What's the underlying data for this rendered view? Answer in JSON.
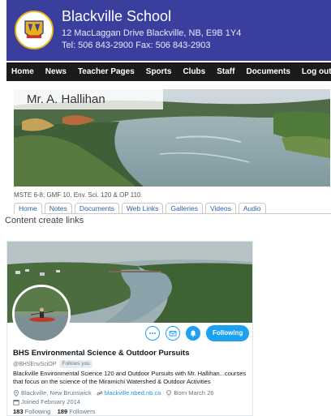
{
  "header": {
    "school_name": "Blackville School",
    "address": "12 MacLaggan Drive Blackville, NB, E9B 1Y4",
    "phone": "Tel: 506 843-2900 Fax: 506 843-2903",
    "brand_color": "#3a3f9e"
  },
  "nav": {
    "items": [
      {
        "label": "Home"
      },
      {
        "label": "News"
      },
      {
        "label": "Teacher Pages"
      },
      {
        "label": "Sports"
      },
      {
        "label": "Clubs"
      },
      {
        "label": "Staff"
      },
      {
        "label": "Documents"
      },
      {
        "label": "Log out"
      }
    ]
  },
  "teacher": {
    "name": "Mr. A. Hallihan",
    "courses": "MSTE 6-8; GMF 10, Env. Sci. 120 & OP 110"
  },
  "tabs": [
    {
      "label": "Home",
      "active": true
    },
    {
      "label": "Notes"
    },
    {
      "label": "Documents"
    },
    {
      "label": "Web Links"
    },
    {
      "label": "Galleries"
    },
    {
      "label": "Videos"
    },
    {
      "label": "Audio"
    }
  ],
  "content": {
    "heading": "Content create links"
  },
  "twitter": {
    "display_name": "BHS Environmental Science & Outdoor Pursuits",
    "handle": "@BHSEnvSciOP",
    "follows_you": "Follows you",
    "bio": "Blackville Environmental Science 120 and Outdoor Pursuits with Mr. Hallihan...courses that focus on the science of the Miramichi Watershed & Outdoor Activities",
    "location": "Blackville, New Brunswick",
    "website": "blackville.nbed.nb.ca",
    "born": "Born March 26",
    "joined": "Joined February 2014",
    "following_count": "183",
    "following_label": "Following",
    "followers_count": "189",
    "followers_label": "Followers",
    "follow_button": "Following",
    "more_icon": "more-icon",
    "accent_color": "#1da1f2"
  }
}
